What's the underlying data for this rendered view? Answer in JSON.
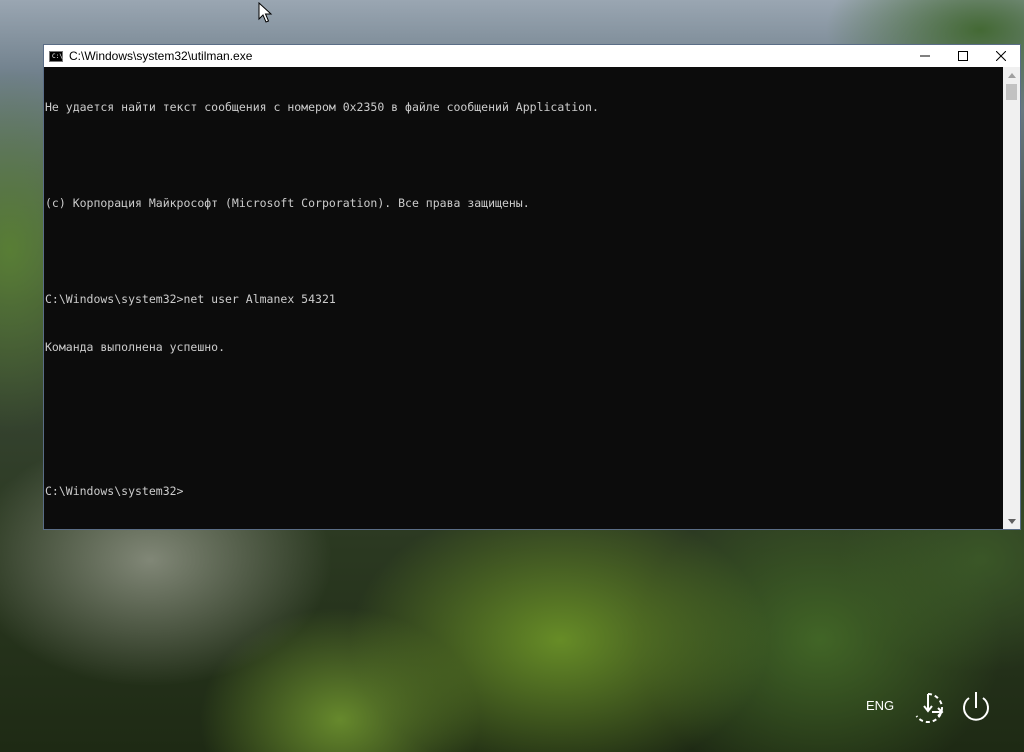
{
  "window": {
    "title": "C:\\Windows\\system32\\utilman.exe",
    "icon_text": "C:\\"
  },
  "console": {
    "lines": [
      "Не удается найти текст сообщения с номером 0x2350 в файле сообщений Application.",
      "",
      "(c) Корпорация Майкрософт (Microsoft Corporation). Все права защищены.",
      "",
      "C:\\Windows\\system32>net user Almanex 54321",
      "Команда выполнена успешно.",
      "",
      "",
      "C:\\Windows\\system32>"
    ]
  },
  "taskbar": {
    "language": "ENG"
  },
  "colors": {
    "console_bg": "#0c0c0c",
    "console_fg": "#cccccc",
    "titlebar_bg": "#ffffff"
  }
}
